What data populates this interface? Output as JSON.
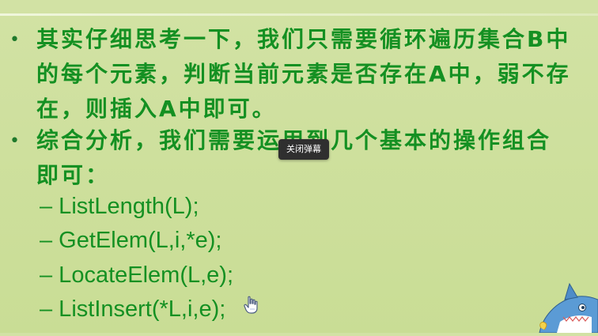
{
  "slide": {
    "bullet_symbol": "•",
    "paragraph1": {
      "line1": "其实仔细思考一下，我们只需要循环遍历集合B中",
      "line2": "的每个元素，判断当前元素是否存在A中，弱不存",
      "line3": "在，则插入A中即可。"
    },
    "paragraph2": {
      "line1": "综合分析，我们需要运用到几个基本的操作组合",
      "line2": "即可："
    },
    "operations": [
      "– ListLength(L);",
      "– GetElem(L,i,*e);",
      "– LocateElem(L,e);",
      "– ListInsert(*L,i,e);"
    ]
  },
  "overlay": {
    "danmaku_tooltip": "关闭弹幕"
  },
  "icons": {
    "cursor": "hand-pointer-icon",
    "mascot": "shark-mascot-icon"
  },
  "colors": {
    "background": "#cfe09c",
    "text": "#149022",
    "tooltip_bg": "#2f2f2f"
  }
}
